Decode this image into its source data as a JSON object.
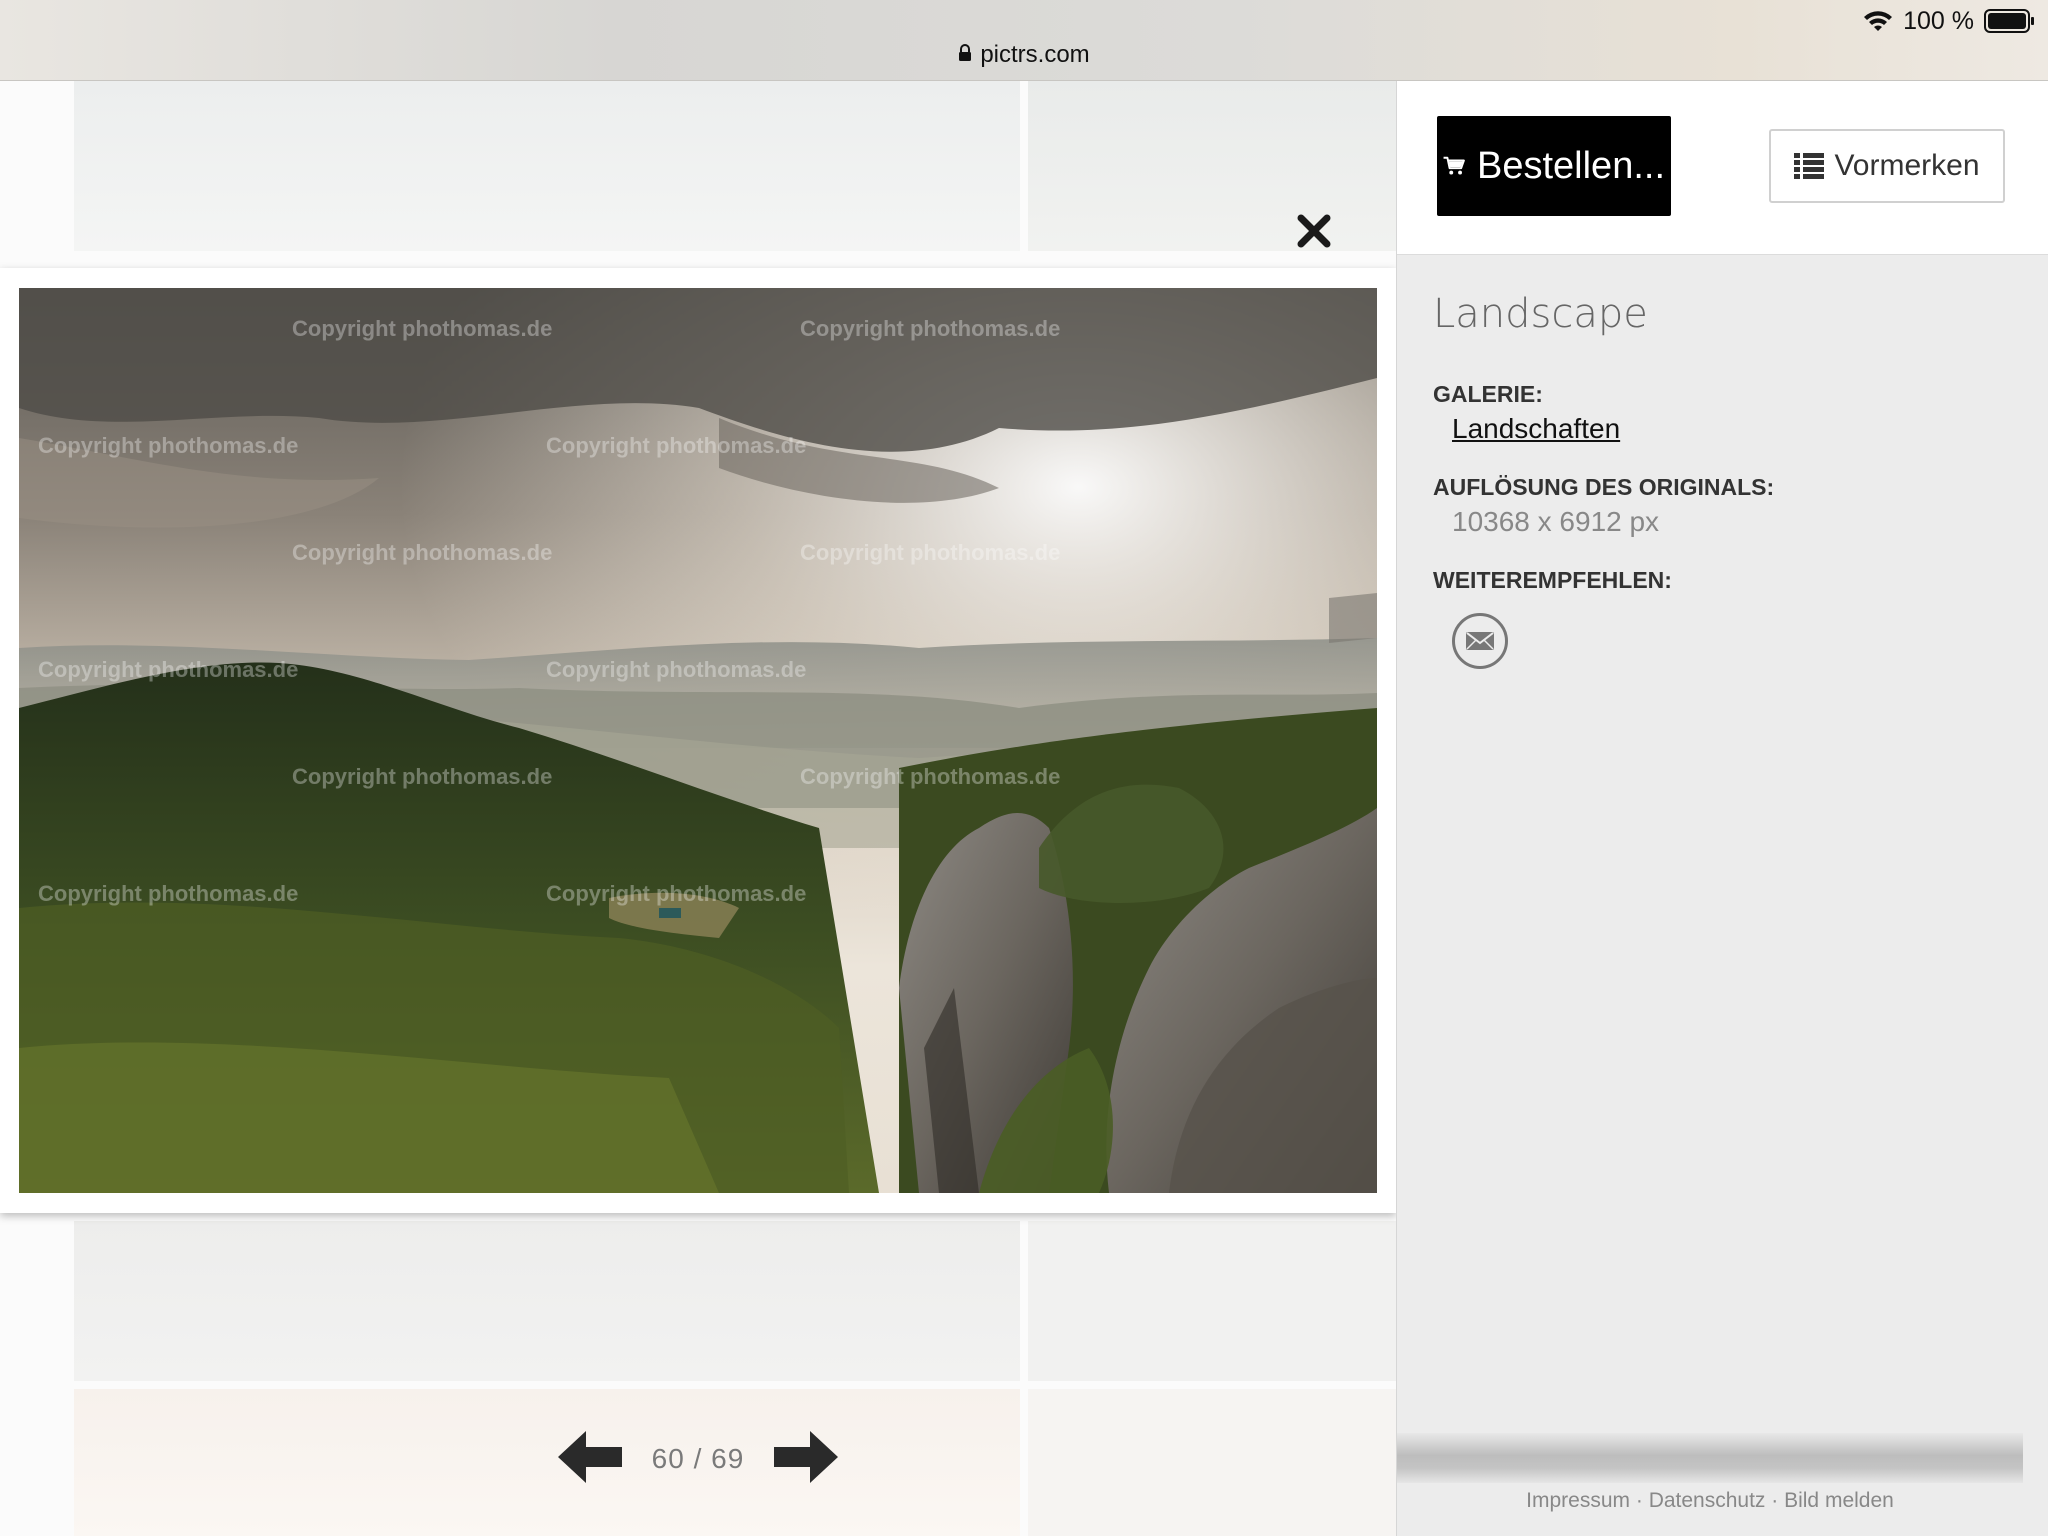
{
  "status_bar": {
    "battery_label": "100 %",
    "url": "pictrs.com"
  },
  "photo": {
    "watermark": "Copyright phothomas.de"
  },
  "pager": {
    "counter": "60 / 69"
  },
  "sidebar": {
    "order_label": "Bestellen...",
    "remember_label": "Vormerken",
    "title": "Landscape",
    "gallery_label": "GALERIE:",
    "gallery_link": "Landschaften",
    "resolution_label": "AUFLÖSUNG DES ORIGINALS:",
    "resolution_value": "10368 x 6912 px",
    "share_label": "WEITEREMPFEHLEN:"
  },
  "footer": {
    "impressum": "Impressum",
    "datenschutz": "Datenschutz",
    "report": "Bild melden",
    "separator": " · "
  },
  "colors": {
    "order_button_bg": "#000000",
    "sidebar_bg": "#ececec"
  },
  "icons": [
    "wifi-icon",
    "battery-icon",
    "lock-icon",
    "close-icon",
    "cart-icon",
    "list-icon",
    "mail-icon",
    "arrow-left-icon",
    "arrow-right-icon"
  ]
}
